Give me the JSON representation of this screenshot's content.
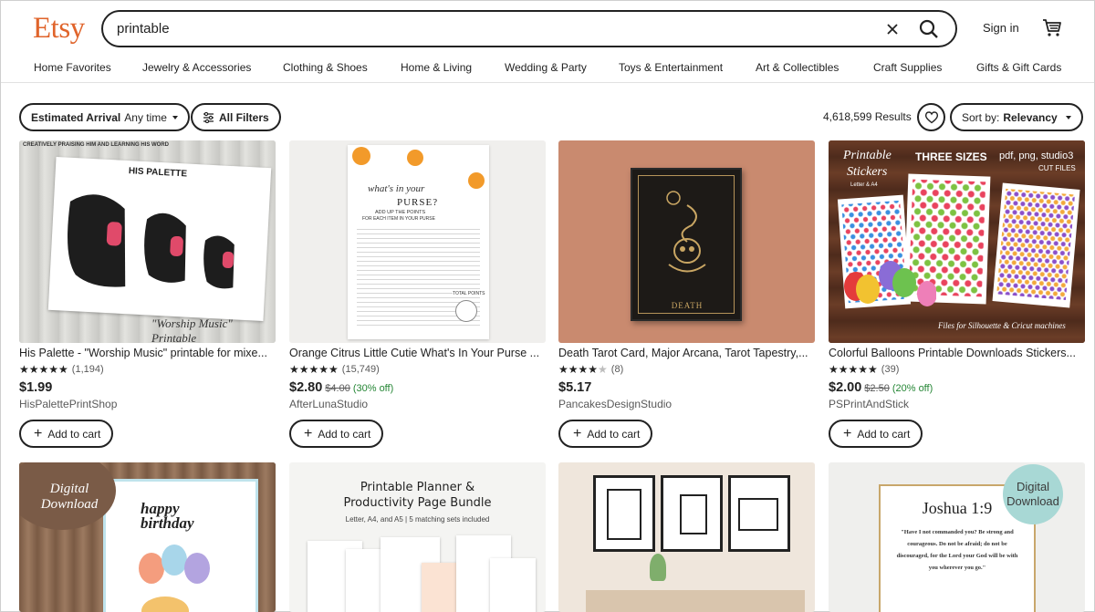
{
  "brand": "Etsy",
  "search": {
    "value": "printable"
  },
  "header": {
    "signin": "Sign in"
  },
  "categories": [
    "Home Favorites",
    "Jewelry & Accessories",
    "Clothing & Shoes",
    "Home & Living",
    "Wedding & Party",
    "Toys & Entertainment",
    "Art & Collectibles",
    "Craft Supplies",
    "Gifts & Gift Cards"
  ],
  "filters": {
    "arrival_label": "Estimated Arrival",
    "arrival_value": "Any time",
    "all_filters": "All Filters",
    "results": "4,618,599 Results",
    "sort_label": "Sort by:",
    "sort_value": "Relevancy"
  },
  "listings": [
    {
      "title": "His Palette - \"Worship Music\" printable for mixe...",
      "stars": 5,
      "reviews": "(1,194)",
      "price": "$1.99",
      "original": "",
      "discount": "",
      "shop": "HisPalettePrintShop",
      "add_label": "Add to cart",
      "image_text": {
        "header": "CREATIVELY PRAISING HIM AND LEARNING HIS WORD",
        "brand": "HIS PALETTE",
        "caption": "\"Worship Music\" Printable"
      }
    },
    {
      "title": "Orange Citrus Little Cutie What's In Your Purse ...",
      "stars": 5,
      "reviews": "(15,749)",
      "price": "$2.80",
      "original": "$4.00",
      "discount": "(30% off)",
      "shop": "AfterLunaStudio",
      "add_label": "Add to cart",
      "image_text": {
        "line1": "what's in your",
        "line2": "PURSE?",
        "line3": "ADD UP THE POINTS",
        "line4": "FOR EACH ITEM IN YOUR PURSE",
        "total": "TOTAL POINTS"
      }
    },
    {
      "title": "Death Tarot Card, Major Arcana, Tarot Tapestry,...",
      "stars": 4,
      "reviews": "(8)",
      "price": "$5.17",
      "original": "",
      "discount": "",
      "shop": "PancakesDesignStudio",
      "add_label": "Add to cart",
      "image_text": {
        "card": "DEATH"
      }
    },
    {
      "title": "Colorful Balloons Printable Downloads Stickers...",
      "stars": 5,
      "reviews": "(39)",
      "price": "$2.00",
      "original": "$2.50",
      "discount": "(20% off)",
      "shop": "PSPrintAndStick",
      "add_label": "Add to cart",
      "image_text": {
        "line1": "Printable",
        "line2": "Stickers",
        "sub": "Letter & A4",
        "sizes": "THREE SIZES",
        "formats": "pdf, png, studio3",
        "cut": "CUT FILES",
        "footer": "Files for Silhouette & Cricut machines"
      }
    }
  ],
  "row2": {
    "badge1": "Digital Download",
    "card1_text": "happy birthday",
    "card2_line1": "Printable Planner &",
    "card2_line2": "Productivity Page Bundle",
    "card2_sub": "Letter, A4, and A5 | 5 matching sets included",
    "badge4": "Digital Download",
    "card4_title": "Joshua 1:9",
    "card4_verse": "\"Have I not commanded you? Be strong and courageous. Do not be afraid; do not be discouraged, for the Lord your God will be with you wherever you go.\""
  },
  "colors": {
    "brand": "#e0642b",
    "discount": "#258635",
    "badge": "#a8d8d5"
  },
  "icons": [
    "close-icon",
    "search-icon",
    "cart-icon",
    "filter-icon",
    "heart-icon",
    "plus-icon"
  ]
}
